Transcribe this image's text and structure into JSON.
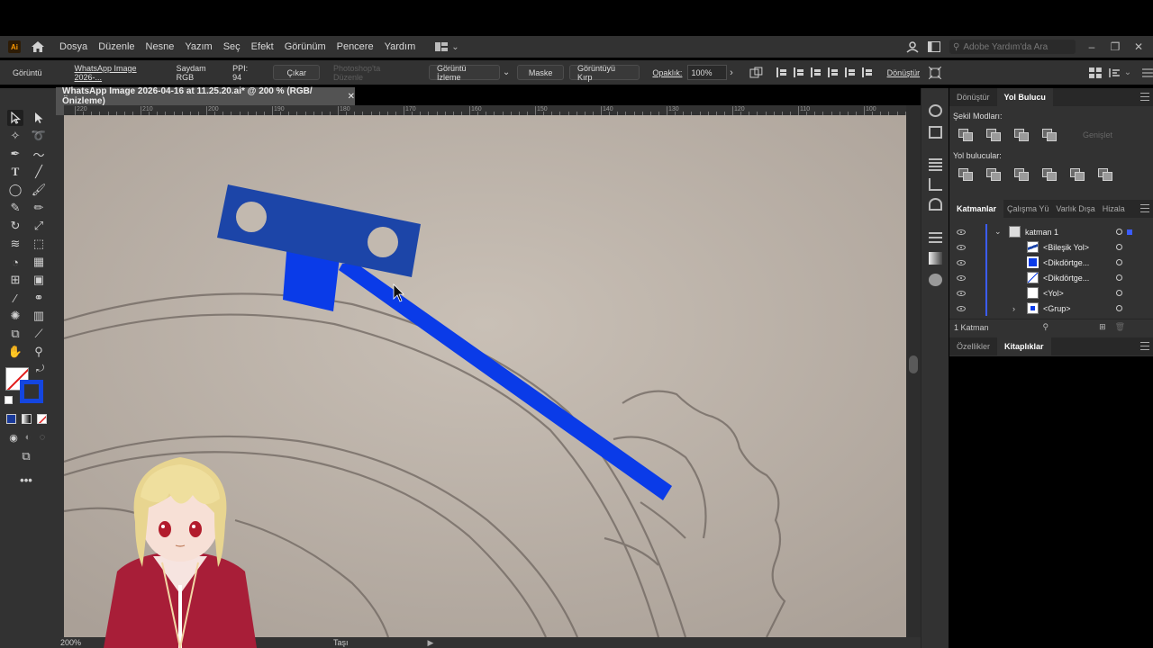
{
  "app": {
    "logo_text": "Ai"
  },
  "menu": [
    "Dosya",
    "Düzenle",
    "Nesne",
    "Yazım",
    "Seç",
    "Efekt",
    "Görünüm",
    "Pencere",
    "Yardım"
  ],
  "search_help": {
    "placeholder": "Adobe Yardım'da Ara"
  },
  "control": {
    "selection_label": "Görüntü",
    "file_name": "WhatsApp Image 2026-...",
    "color_mode": "Saydam RGB",
    "ppi": "PPI: 94",
    "extract_btn": "Çıkar",
    "edit_ps_btn": "Photoshop'ta Düzenle",
    "trace_btn": "Görüntü İzleme",
    "mask_btn": "Maske",
    "crop_btn": "Görüntüyü Kırp",
    "opacity_label": "Opaklık:",
    "opacity_value": "100%",
    "transform_btn": "Dönüştür"
  },
  "document": {
    "tab_title": "WhatsApp Image 2026-04-16 at 11.25.20.ai* @ 200 % (RGB/Önizleme)",
    "zoom": "200%",
    "status_tool": "Taşı",
    "ruler_labels": [
      "220",
      "210",
      "200",
      "190",
      "180",
      "170",
      "160",
      "150",
      "140",
      "130",
      "120",
      "110",
      "100"
    ]
  },
  "panels": {
    "top_tabs": [
      "Dönüştür",
      "Yol Bulucu"
    ],
    "shape_modes_label": "Şekil Modları:",
    "expand_label": "Genişlet",
    "pathfinders_label": "Yol bulucular:",
    "layer_tabs": [
      "Katmanlar",
      "Çalışma Yü",
      "Varlık Dışa",
      "Hizala"
    ],
    "layers": [
      {
        "name": "katman 1"
      },
      {
        "name": "<Bileşik Yol>"
      },
      {
        "name": "<Dikdörtge..."
      },
      {
        "name": "<Dikdörtge..."
      },
      {
        "name": "<Yol>"
      },
      {
        "name": "<Grup>"
      }
    ],
    "layers_count": "1 Katman",
    "bottom_tabs": [
      "Özellikler",
      "Kitaplıklar"
    ]
  },
  "colors": {
    "accent_blue": "#0a3be8",
    "dark_blue": "#1c45a8",
    "paper": "#bdb3a9",
    "ui_dark": "#323232"
  }
}
